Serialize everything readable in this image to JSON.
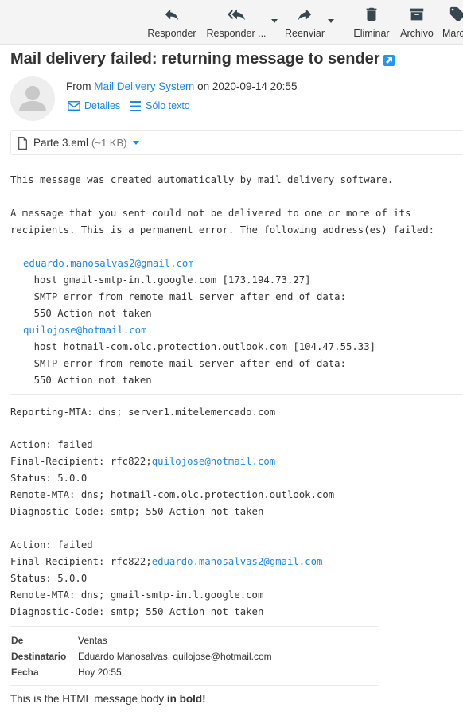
{
  "toolbar": {
    "reply": "Responder",
    "reply_all": "Responder ...",
    "forward": "Reenviar",
    "delete": "Eliminar",
    "archive": "Archivo",
    "mark": "Marcar"
  },
  "message": {
    "subject": "Mail delivery failed: returning message to sender",
    "from_prefix": "From",
    "from_name": "Mail Delivery System",
    "date_prefix": "on",
    "date": "2020-09-14 20:55",
    "details_label": "Detalles",
    "plain_text_label": "Sólo texto"
  },
  "attachment": {
    "name": "Parte 3.eml",
    "size": "(~1 KB)"
  },
  "body": {
    "line_intro": "This message was created automatically by mail delivery software.",
    "line_fail_1": "A message that you sent could not be delivered to one or more of its",
    "line_fail_2": "recipients. This is a permanent error. The following address(es) failed:",
    "recipient1": "eduardo.manosalvas2@gmail.com",
    "r1_host": "    host gmail-smtp-in.l.google.com [173.194.73.27]",
    "r1_smtp": "    SMTP error from remote mail server after end of data:",
    "r1_code": "    550 Action not taken",
    "recipient2": "quilojose@hotmail.com",
    "r2_host": "    host hotmail-com.olc.protection.outlook.com [104.47.55.33]",
    "r2_smtp": "    SMTP error from remote mail server after end of data:",
    "r2_code": "    550 Action not taken"
  },
  "report": {
    "reporting_mta": "Reporting-MTA: dns; server1.mitelemercado.com",
    "block1": {
      "action": "Action: failed",
      "final_recipient_prefix": "Final-Recipient: rfc822;",
      "final_recipient": "quilojose@hotmail.com",
      "status": "Status: 5.0.0",
      "remote_mta": "Remote-MTA: dns; hotmail-com.olc.protection.outlook.com",
      "diagnostic": "Diagnostic-Code: smtp; 550 Action not taken"
    },
    "block2": {
      "action": "Action: failed",
      "final_recipient_prefix": "Final-Recipient: rfc822;",
      "final_recipient": "eduardo.manosalvas2@gmail.com",
      "status": "Status: 5.0.0",
      "remote_mta": "Remote-MTA: dns; gmail-smtp-in.l.google.com",
      "diagnostic": "Diagnostic-Code: smtp; 550 Action not taken"
    }
  },
  "embedded": {
    "from_label": "De",
    "from_value": "Ventas",
    "to_label": "Destinatario",
    "to_value": "Eduardo Manosalvas, quilojose@hotmail.com",
    "date_label": "Fecha",
    "date_value": "Hoy 20:55",
    "html_body_prefix": "This is the HTML message body ",
    "html_body_bold": "in bold!"
  },
  "icons": {
    "reply": "reply-icon",
    "reply_all": "reply-all-icon",
    "forward": "forward-icon",
    "delete": "trash-icon",
    "archive": "archive-icon",
    "mark": "tag-icon",
    "external": "open-external-icon",
    "details": "envelope-icon",
    "plain": "list-icon",
    "file": "file-icon"
  },
  "colors": {
    "link": "#1e88e5",
    "toolbar_bg": "#f4f4f4",
    "text": "#333333"
  }
}
